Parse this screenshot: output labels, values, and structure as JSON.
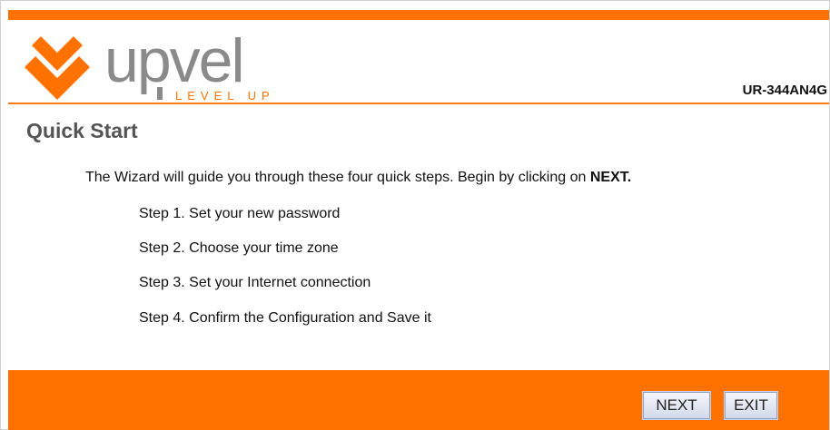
{
  "header": {
    "brand_name": "upvel",
    "brand_tagline": "LEVEL UP",
    "model": "UR-344AN4G"
  },
  "page": {
    "title": "Quick Start",
    "intro_text": "The Wizard will guide you through these four quick steps. Begin by clicking on ",
    "intro_emphasis": "NEXT.",
    "steps": [
      "Step 1. Set your new password",
      "Step 2. Choose your time zone",
      "Step 3. Set your Internet connection",
      "Step 4. Confirm the Configuration and Save it"
    ]
  },
  "buttons": {
    "next_label": "NEXT",
    "exit_label": "EXIT"
  },
  "colors": {
    "accent_orange": "#ff7200",
    "logo_gray": "#8a8a8a",
    "title_gray": "#555555"
  }
}
